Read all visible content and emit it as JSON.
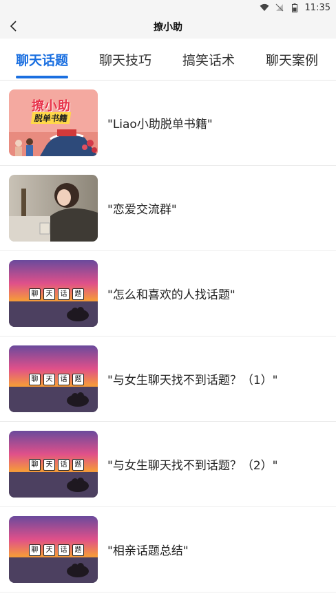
{
  "status": {
    "time": "11:35",
    "icons": [
      "wifi-icon",
      "signal-off-icon",
      "battery-icon"
    ]
  },
  "header": {
    "title": "撩小助"
  },
  "tabs": [
    {
      "label": "聊天话题",
      "active": true
    },
    {
      "label": "聊天技巧",
      "active": false
    },
    {
      "label": "搞笑话术",
      "active": false
    },
    {
      "label": "聊天案例",
      "active": false
    }
  ],
  "items": [
    {
      "title": "\"Liao小助脱单书籍\"",
      "thumb_text_1": "撩小助",
      "thumb_text_2": "脱单书籍"
    },
    {
      "title": "\"恋爱交流群\""
    },
    {
      "title": "\"怎么和喜欢的人找话题\"",
      "badges": [
        "聊",
        "天",
        "话",
        "题"
      ]
    },
    {
      "title": "\"与女生聊天找不到话题？（1）\"",
      "badges": [
        "聊",
        "天",
        "话",
        "题"
      ]
    },
    {
      "title": "\"与女生聊天找不到话题？（2）\"",
      "badges": [
        "聊",
        "天",
        "话",
        "题"
      ]
    },
    {
      "title": "\"相亲话题总结\"",
      "badges": [
        "聊",
        "天",
        "话",
        "题"
      ]
    }
  ],
  "colors": {
    "accent": "#1a6fe0",
    "header_bg": "#f5f5f5"
  }
}
